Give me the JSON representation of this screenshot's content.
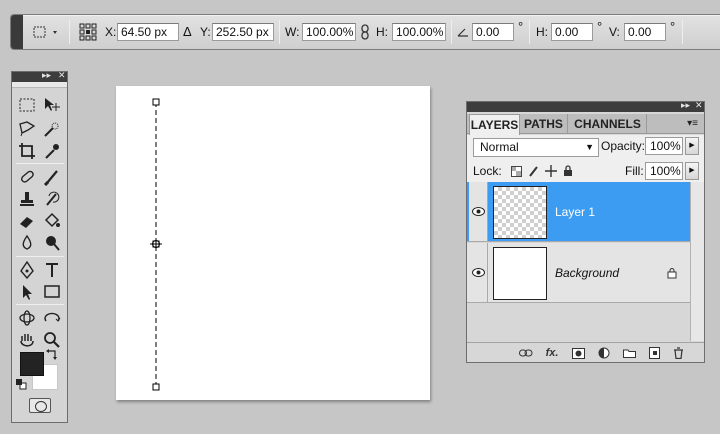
{
  "options_bar": {
    "x_label": "X:",
    "x_value": "64.50 px",
    "delta_label": "Δ",
    "y_label": "Y:",
    "y_value": "252.50 px",
    "w_label": "W:",
    "w_value": "100.00%",
    "h_label": "H:",
    "h_value": "100.00%",
    "angle_value": "0.00",
    "hskew_label": "H:",
    "hskew_value": "0.00",
    "vskew_label": "V:",
    "vskew_value": "0.00",
    "degree": "°"
  },
  "layers_panel": {
    "tabs": [
      {
        "label": "LAYERS",
        "active": true
      },
      {
        "label": "PATHS",
        "active": false
      },
      {
        "label": "CHANNELS",
        "active": false
      }
    ],
    "blend_mode": "Normal",
    "opacity_label": "Opacity:",
    "opacity_value": "100%",
    "lock_label": "Lock:",
    "fill_label": "Fill:",
    "fill_value": "100%",
    "layers": [
      {
        "name": "Layer 1",
        "selected": true,
        "visible": true
      },
      {
        "name": "Background",
        "selected": false,
        "visible": true,
        "locked": true
      }
    ]
  },
  "colors": {
    "foreground": "#232323",
    "background": "#ffffff",
    "selection": "#3c9cf2"
  }
}
